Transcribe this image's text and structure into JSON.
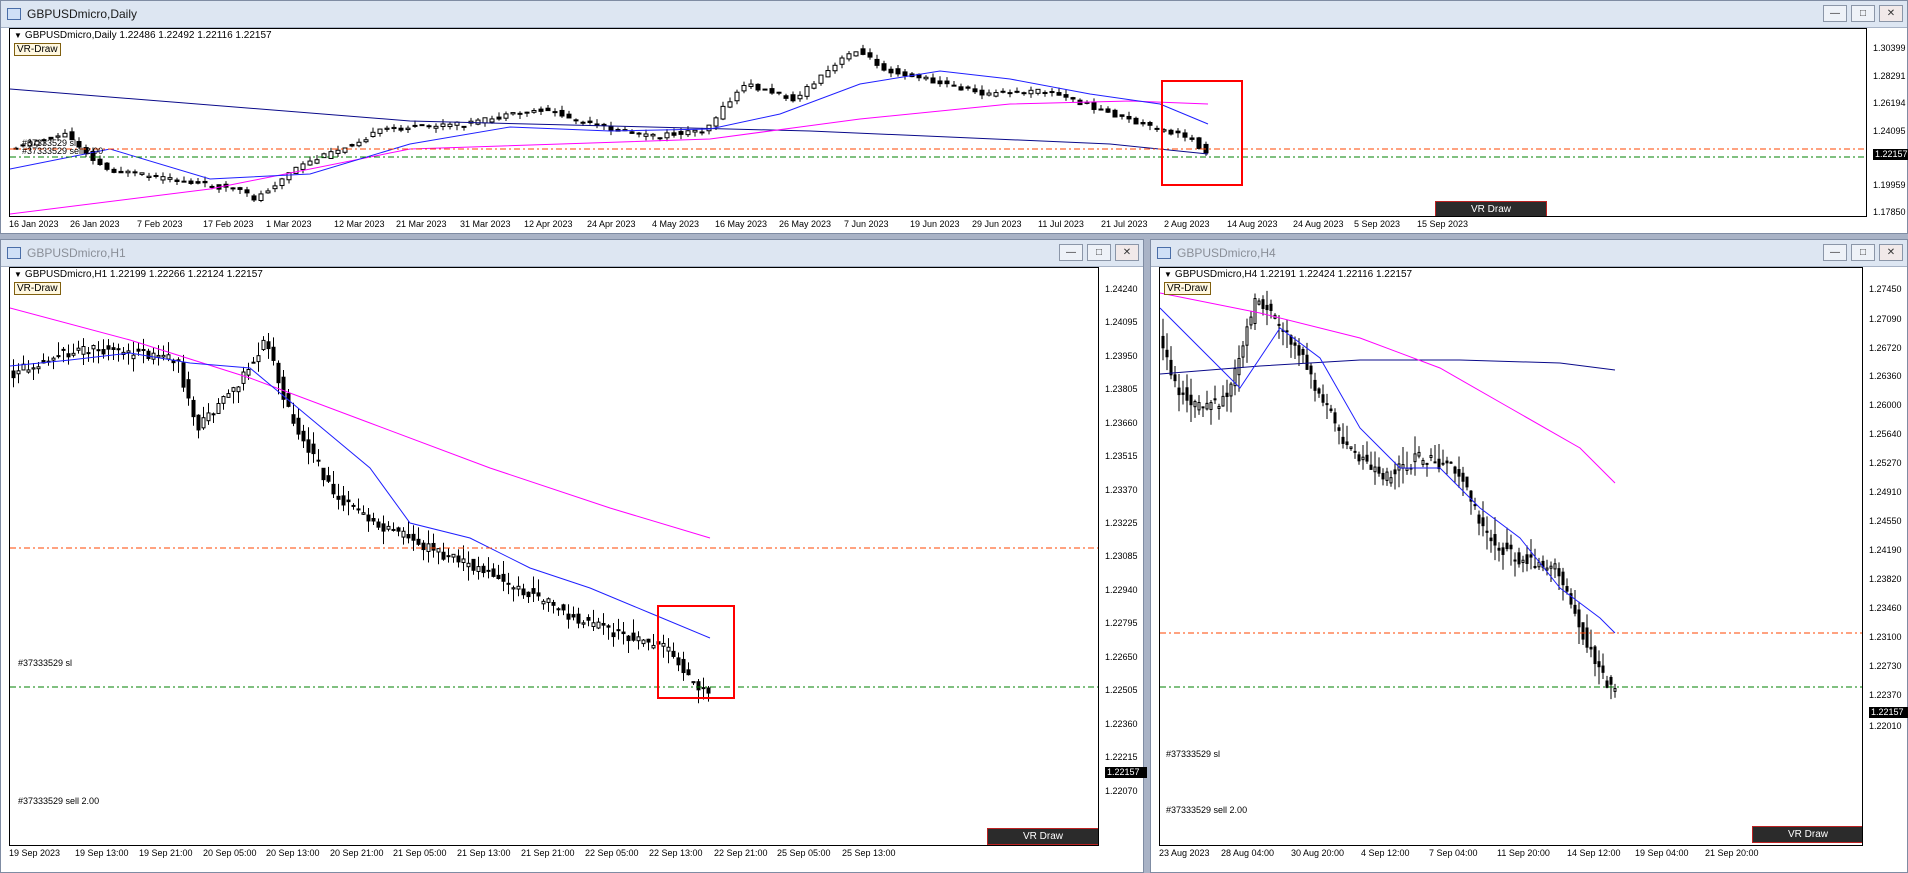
{
  "colors": {
    "ma_fast": "#1f1fff",
    "ma_slow": "#ff00ff",
    "ma_long": "#0a0a8a",
    "sl_line": "#ff4500",
    "entry_line": "#008000",
    "box": "#ff0000"
  },
  "daily": {
    "window_title": "GBPUSDmicro,Daily",
    "header": "GBPUSDmicro,Daily  1.22486 1.22492 1.22116 1.22157",
    "vr_label": "VR-Draw",
    "vr_button": "VR Draw",
    "sl_label": "#37333529 sl",
    "entry_label": "#37333529 sell 2.00",
    "price_ticks": [
      "1.30399",
      "1.28291",
      "1.26194",
      "1.24095",
      "1.22157",
      "1.19959",
      "1.17850"
    ],
    "current_price": "1.22157",
    "time_ticks": [
      "16 Jan 2023",
      "26 Jan 2023",
      "7 Feb 2023",
      "17 Feb 2023",
      "1 Mar 2023",
      "12 Mar 2023",
      "21 Mar 2023",
      "31 Mar 2023",
      "12 Apr 2023",
      "24 Apr 2023",
      "4 May 2023",
      "16 May 2023",
      "26 May 2023",
      "7 Jun 2023",
      "19 Jun 2023",
      "29 Jun 2023",
      "11 Jul 2023",
      "21 Jul 2023",
      "2 Aug 2023",
      "14 Aug 2023",
      "24 Aug 2023",
      "5 Sep 2023",
      "15 Sep 2023"
    ]
  },
  "h1": {
    "window_title": "GBPUSDmicro,H1",
    "header": "GBPUSDmicro,H1  1.22199 1.22266 1.22124 1.22157",
    "vr_label": "VR-Draw",
    "vr_button": "VR Draw",
    "sl_label": "#37333529 sl",
    "entry_label": "#37333529 sell 2.00",
    "price_ticks": [
      "1.24240",
      "1.24095",
      "1.23950",
      "1.23805",
      "1.23660",
      "1.23515",
      "1.23370",
      "1.23225",
      "1.23085",
      "1.22940",
      "1.22795",
      "1.22650",
      "1.22505",
      "1.22360",
      "1.22215",
      "1.22070"
    ],
    "current_price": "1.22157",
    "time_ticks": [
      "19 Sep 2023",
      "19 Sep 13:00",
      "19 Sep 21:00",
      "20 Sep 05:00",
      "20 Sep 13:00",
      "20 Sep 21:00",
      "21 Sep 05:00",
      "21 Sep 13:00",
      "21 Sep 21:00",
      "22 Sep 05:00",
      "22 Sep 13:00",
      "22 Sep 21:00",
      "25 Sep 05:00",
      "25 Sep 13:00"
    ]
  },
  "h4": {
    "window_title": "GBPUSDmicro,H4",
    "header": "GBPUSDmicro,H4  1.22191 1.22424 1.22116 1.22157",
    "vr_label": "VR-Draw",
    "vr_button": "VR Draw",
    "sl_label": "#37333529 sl",
    "entry_label": "#37333529 sell 2.00",
    "price_ticks": [
      "1.27450",
      "1.27090",
      "1.26720",
      "1.26360",
      "1.26000",
      "1.25640",
      "1.25270",
      "1.24910",
      "1.24550",
      "1.24190",
      "1.23820",
      "1.23460",
      "1.23100",
      "1.22730",
      "1.22370",
      "1.22010"
    ],
    "current_price": "1.22157",
    "time_ticks": [
      "23 Aug 2023",
      "28 Aug 04:00",
      "30 Aug 20:00",
      "4 Sep 12:00",
      "7 Sep 04:00",
      "11 Sep 20:00",
      "14 Sep 12:00",
      "19 Sep 04:00",
      "21 Sep 20:00"
    ]
  }
}
